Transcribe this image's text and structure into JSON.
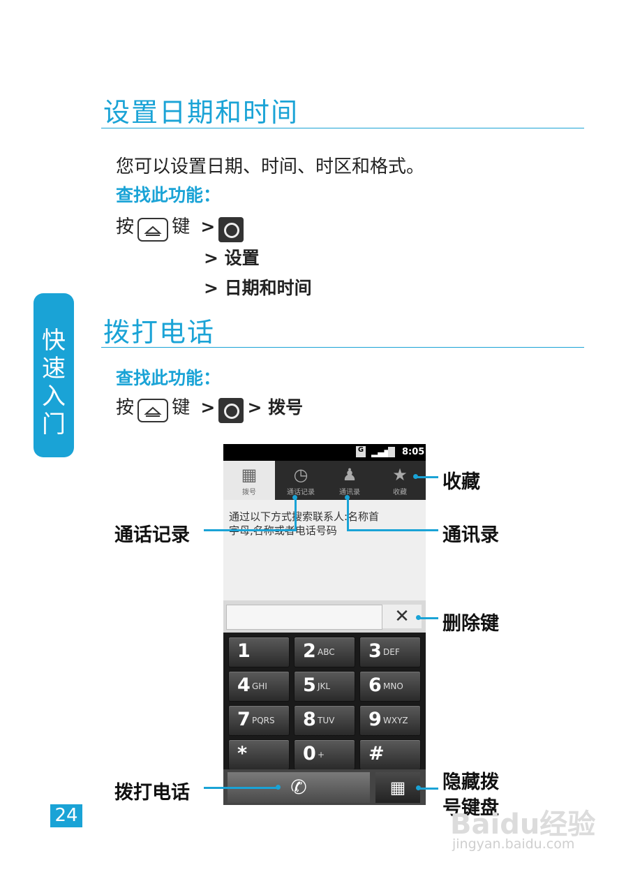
{
  "section1": {
    "title": "设置日期和时间",
    "intro": "您可以设置日期、时间、时区和格式。",
    "find_label": "查找此功能：",
    "press": "按",
    "key": "键",
    "arrow": ">",
    "step2": "> 设置",
    "step3": "> 日期和时间"
  },
  "section2": {
    "title": "拨打电话",
    "find_label": "查找此功能：",
    "press": "按",
    "key": "键",
    "arrow": ">",
    "step_end": "> 拨号"
  },
  "side_tab": [
    "快",
    "速",
    "入",
    "门"
  ],
  "page_number": "24",
  "phone": {
    "status_time": "8:05",
    "tabs": [
      {
        "label": "拨号",
        "icon": "dialpad-icon"
      },
      {
        "label": "通话记录",
        "icon": "clock-icon"
      },
      {
        "label": "通讯录",
        "icon": "person-icon"
      },
      {
        "label": "收藏",
        "icon": "star-icon"
      }
    ],
    "hint_line1": "通过以下方式搜索联系人:名称首",
    "hint_line2": "字母,名称或者电话号码",
    "keys": [
      {
        "d": "1",
        "l": ""
      },
      {
        "d": "2",
        "l": "ABC"
      },
      {
        "d": "3",
        "l": "DEF"
      },
      {
        "d": "4",
        "l": "GHI"
      },
      {
        "d": "5",
        "l": "JKL"
      },
      {
        "d": "6",
        "l": "MNO"
      },
      {
        "d": "7",
        "l": "PQRS"
      },
      {
        "d": "8",
        "l": "TUV"
      },
      {
        "d": "9",
        "l": "WXYZ"
      },
      {
        "d": "*",
        "l": ""
      },
      {
        "d": "0",
        "l": "+"
      },
      {
        "d": "#",
        "l": ""
      }
    ]
  },
  "callouts": {
    "favorites": "收藏",
    "call_log": "通话记录",
    "contacts": "通讯录",
    "delete_key": "删除键",
    "make_call": "拨打电话",
    "hide_keypad_1": "隐藏拨",
    "hide_keypad_2": "号键盘"
  },
  "watermark": {
    "brand": "Baidu经验",
    "url": "jingyan.baidu.com"
  }
}
